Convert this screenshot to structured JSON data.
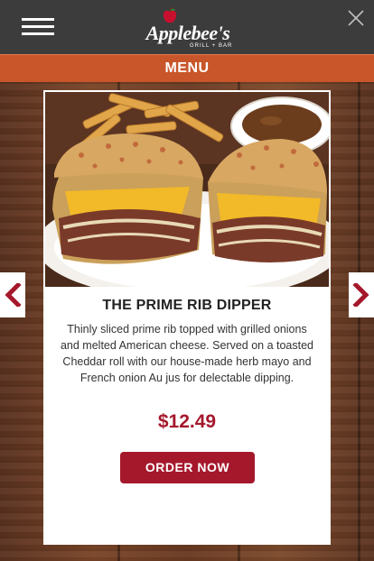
{
  "header": {
    "logo_text": "Applebee's",
    "logo_subtext": "GRILL + BAR",
    "menu_icon": "hamburger-menu-icon",
    "close_icon": "close-icon",
    "apple_icon": "apple-logo-icon"
  },
  "menu_bar": {
    "label": "MENU"
  },
  "carousel": {
    "prev_icon": "chevron-left-icon",
    "next_icon": "chevron-right-icon"
  },
  "item": {
    "title": "THE PRIME RIB DIPPER",
    "description": "Thinly sliced prime rib topped with grilled onions and melted American cheese. Served on a toasted Cheddar roll with our house-made herb mayo and French onion Au jus for delectable dipping.",
    "price": "$12.49",
    "order_label": "ORDER NOW"
  },
  "colors": {
    "top_bar": "#3c3c3c",
    "menu_bar": "#c8562a",
    "accent_red": "#a5182c"
  }
}
